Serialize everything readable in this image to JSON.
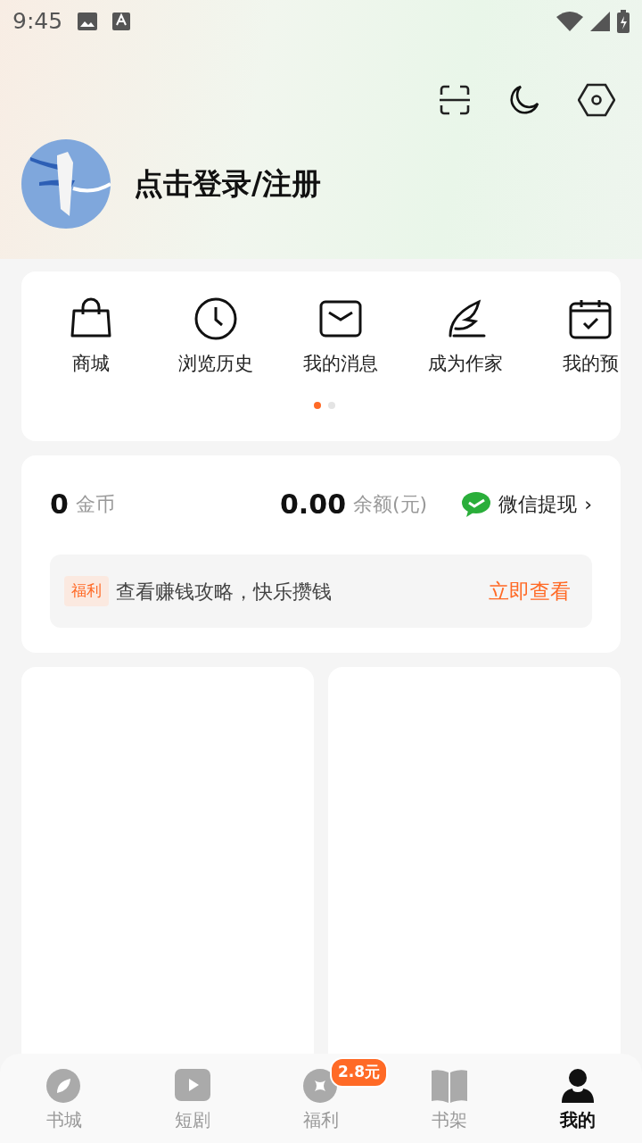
{
  "status_bar": {
    "time": "9:45"
  },
  "profile": {
    "login_text": "点击登录/注册"
  },
  "shortcuts": [
    {
      "label": "商城"
    },
    {
      "label": "浏览历史"
    },
    {
      "label": "我的消息"
    },
    {
      "label": "成为作家"
    },
    {
      "label": "我的预"
    }
  ],
  "pager": [
    {
      "selected": true
    },
    {
      "selected": false
    }
  ],
  "wallet": {
    "coins": "0",
    "coins_label": "金币",
    "balance": "0.00",
    "balance_label": "余额(元)",
    "withdraw": "微信提现",
    "withdraw_arrow": "›"
  },
  "promo": {
    "tag": "福利",
    "text": "查看赚钱攻略，快乐攒钱",
    "action": "立即查看"
  },
  "bottom_nav": [
    {
      "label": "书城",
      "selected": false
    },
    {
      "label": "短剧",
      "selected": false
    },
    {
      "label": "福利",
      "selected": false,
      "badge": "2.8元"
    },
    {
      "label": "书架",
      "selected": false
    },
    {
      "label": "我的",
      "selected": true
    }
  ]
}
